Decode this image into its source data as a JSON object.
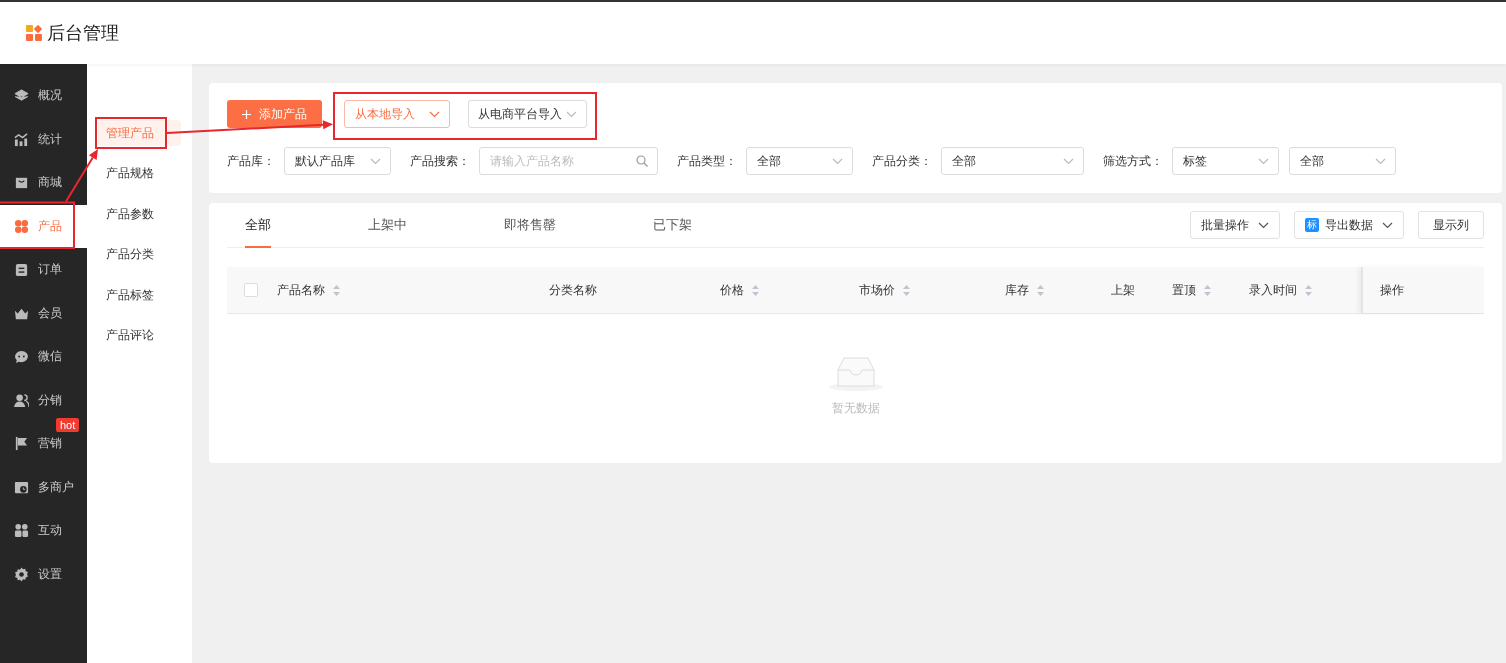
{
  "header": {
    "title": "后台管理"
  },
  "sidebar": {
    "items": [
      {
        "label": "概况",
        "selected": false,
        "annotated": false
      },
      {
        "label": "统计",
        "selected": false,
        "annotated": false
      },
      {
        "label": "商城",
        "selected": false,
        "annotated": false
      },
      {
        "label": "产品",
        "selected": true,
        "annotated": true
      },
      {
        "label": "订单",
        "selected": false,
        "annotated": false
      },
      {
        "label": "会员",
        "selected": false,
        "annotated": false
      },
      {
        "label": "微信",
        "selected": false,
        "annotated": false
      },
      {
        "label": "分销",
        "selected": false,
        "annotated": false
      },
      {
        "label": "营销",
        "selected": false,
        "annotated": false,
        "badge": "hot"
      },
      {
        "label": "多商户",
        "selected": false,
        "annotated": false
      },
      {
        "label": "互动",
        "selected": false,
        "annotated": false
      },
      {
        "label": "设置",
        "selected": false,
        "annotated": false
      }
    ]
  },
  "submenu": {
    "items": [
      {
        "label": "管理产品",
        "selected": true,
        "annotated": true
      },
      {
        "label": "产品规格",
        "selected": false,
        "annotated": false
      },
      {
        "label": "产品参数",
        "selected": false,
        "annotated": false
      },
      {
        "label": "产品分类",
        "selected": false,
        "annotated": false
      },
      {
        "label": "产品标签",
        "selected": false,
        "annotated": false
      },
      {
        "label": "产品评论",
        "selected": false,
        "annotated": false
      }
    ]
  },
  "toolbar": {
    "add_button": "添加产品",
    "import_group": {
      "annotated": true,
      "dropdowns": [
        {
          "label": "从本地导入",
          "selected": true
        },
        {
          "label": "从电商平台导入",
          "selected": false
        }
      ]
    }
  },
  "filters": [
    {
      "label": "产品库：",
      "kind": "select",
      "value": "默认产品库"
    },
    {
      "label": "产品搜索：",
      "kind": "search",
      "placeholder": "请输入产品名称"
    },
    {
      "label": "产品类型：",
      "kind": "select",
      "value": "全部"
    },
    {
      "label": "产品分类：",
      "kind": "select",
      "value": "全部"
    },
    {
      "label": "筛选方式：",
      "kind": "select",
      "value": "标签"
    },
    {
      "kind": "select",
      "value": "全部"
    }
  ],
  "tabs": [
    {
      "label": "全部",
      "selected": true
    },
    {
      "label": "上架中",
      "selected": false
    },
    {
      "label": "即将售罄",
      "selected": false
    },
    {
      "label": "已下架",
      "selected": false
    }
  ],
  "actions": [
    {
      "label": "批量操作",
      "kind": "dropdown"
    },
    {
      "label": "导出数据",
      "kind": "dropdown",
      "tag": "标"
    },
    {
      "label": "显示列",
      "kind": "button"
    }
  ],
  "table": {
    "select_all": {
      "checked": false
    },
    "columns": [
      {
        "label": "产品名称",
        "sortable": true
      },
      {
        "label": "分类名称",
        "sortable": false
      },
      {
        "label": "价格",
        "sortable": true
      },
      {
        "label": "市场价",
        "sortable": true
      },
      {
        "label": "库存",
        "sortable": true
      },
      {
        "label": "上架",
        "sortable": false
      },
      {
        "label": "置顶",
        "sortable": true
      },
      {
        "label": "录入时间",
        "sortable": true
      },
      {
        "label": "操作",
        "sortable": false
      }
    ],
    "empty_text": "暂无数据"
  }
}
